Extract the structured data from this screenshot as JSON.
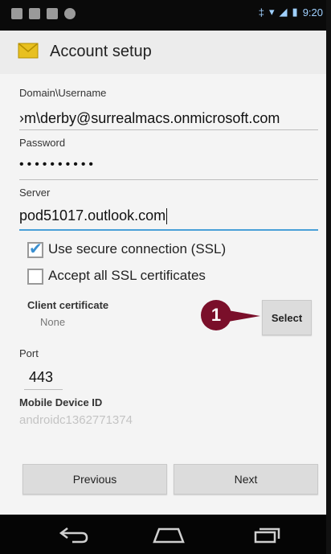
{
  "status_bar": {
    "time": "9:20"
  },
  "action_bar": {
    "title": "Account setup"
  },
  "form": {
    "domain_label": "Domain\\Username",
    "domain_value": "›m\\derby@surrealmacs.onmicrosoft.com",
    "password_label": "Password",
    "password_value": "••••••••••",
    "server_label": "Server",
    "server_value": "pod51017.outlook.com",
    "ssl_label": "Use secure connection (SSL)",
    "ssl_checked": true,
    "accept_ssl_label": "Accept all SSL certificates",
    "accept_ssl_checked": false,
    "client_cert_label": "Client certificate",
    "client_cert_value": "None",
    "select_label": "Select",
    "port_label": "Port",
    "port_value": "443",
    "device_id_label": "Mobile Device ID",
    "device_id_value": "androidc1362771374"
  },
  "marker": {
    "number": "1"
  },
  "buttons": {
    "previous": "Previous",
    "next": "Next"
  },
  "colors": {
    "accent": "#4aa0d8",
    "marker": "#7a0f2a"
  }
}
